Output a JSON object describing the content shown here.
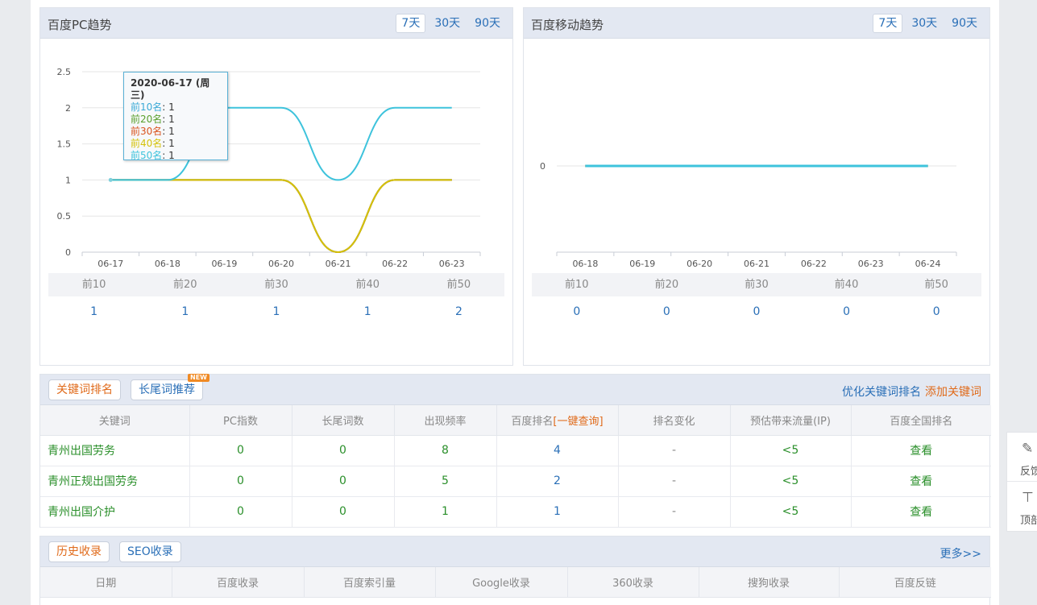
{
  "pc_trend": {
    "title": "百度PC趋势",
    "ranges": [
      "7天",
      "30天",
      "90天"
    ],
    "active_range": "7天",
    "tooltip": {
      "title": "2020-06-17 (周三)",
      "rows": [
        {
          "label": "前10名",
          "value": ": 1",
          "color": "#3aa9d6"
        },
        {
          "label": "前20名",
          "value": ": 1",
          "color": "#5aa02c"
        },
        {
          "label": "前30名",
          "value": ": 1",
          "color": "#d9541e"
        },
        {
          "label": "前40名",
          "value": ": 1",
          "color": "#d4c20a"
        },
        {
          "label": "前50名",
          "value": ": 1",
          "color": "#3ec3dc"
        }
      ]
    },
    "summary": {
      "headers": [
        "前10",
        "前20",
        "前30",
        "前40",
        "前50"
      ],
      "values": [
        "1",
        "1",
        "1",
        "1",
        "2"
      ]
    }
  },
  "mobile_trend": {
    "title": "百度移动趋势",
    "ranges": [
      "7天",
      "30天",
      "90天"
    ],
    "active_range": "7天",
    "summary": {
      "headers": [
        "前10",
        "前20",
        "前30",
        "前40",
        "前50"
      ],
      "values": [
        "0",
        "0",
        "0",
        "0",
        "0"
      ]
    }
  },
  "chart_data": [
    {
      "type": "line",
      "categories": [
        "06-17",
        "06-18",
        "06-19",
        "06-20",
        "06-21",
        "06-22",
        "06-23"
      ],
      "yticks": [
        "0",
        "0.5",
        "1",
        "1.5",
        "2",
        "2.5"
      ],
      "ylim": [
        0,
        2.5
      ],
      "legend_position": "bottom",
      "series": [
        {
          "name": "前10名",
          "color": "#3aa9d6",
          "values": [
            1,
            1,
            1,
            1,
            0,
            1,
            1
          ]
        },
        {
          "name": "前20名",
          "color": "#5aa02c",
          "values": [
            1,
            1,
            1,
            1,
            0,
            1,
            1
          ]
        },
        {
          "name": "前30名",
          "color": "#d9541e",
          "values": [
            1,
            1,
            1,
            1,
            0,
            1,
            1
          ]
        },
        {
          "name": "前40名",
          "color": "#d4c20a",
          "values": [
            1,
            1,
            1,
            1,
            0,
            1,
            1
          ]
        },
        {
          "name": "前50名",
          "color": "#3ec3dc",
          "values": [
            1,
            1,
            2,
            2,
            1,
            2,
            2
          ]
        }
      ]
    },
    {
      "type": "line",
      "categories": [
        "06-18",
        "06-19",
        "06-20",
        "06-21",
        "06-22",
        "06-23",
        "06-24"
      ],
      "yticks": [
        "0"
      ],
      "legend_position": "bottom",
      "series": [
        {
          "name": "前10名",
          "color": "#3aa9d6",
          "values": [
            0,
            0,
            0,
            0,
            0,
            0,
            0
          ]
        },
        {
          "name": "前20名",
          "color": "#5aa02c",
          "values": [
            0,
            0,
            0,
            0,
            0,
            0,
            0
          ]
        },
        {
          "name": "前30名",
          "color": "#d9541e",
          "values": [
            0,
            0,
            0,
            0,
            0,
            0,
            0
          ]
        },
        {
          "name": "前40名",
          "color": "#d4c20a",
          "values": [
            0,
            0,
            0,
            0,
            0,
            0,
            0
          ]
        },
        {
          "name": "前50名",
          "color": "#3ec3dc",
          "values": [
            0,
            0,
            0,
            0,
            0,
            0,
            0
          ]
        }
      ]
    }
  ],
  "keywords": {
    "tabs": [
      "关键词排名",
      "长尾词推荐"
    ],
    "new_badge": "NEW",
    "link_optimize": "优化关键词排名",
    "link_add": "添加关键词",
    "columns": [
      "关键词",
      "PC指数",
      "长尾词数",
      "出现频率",
      "百度排名",
      "[一键查询]",
      "排名变化",
      "预估带来流量(IP)",
      "百度全国排名"
    ],
    "rows": [
      {
        "keyword": "青州出国劳务",
        "pc_index": "0",
        "longtail": "0",
        "frequency": "8",
        "rank": "4",
        "change": "-",
        "traffic": "<5",
        "national": "查看"
      },
      {
        "keyword": "青州正规出国劳务",
        "pc_index": "0",
        "longtail": "0",
        "frequency": "5",
        "rank": "2",
        "change": "-",
        "traffic": "<5",
        "national": "查看"
      },
      {
        "keyword": "青州出国介护",
        "pc_index": "0",
        "longtail": "0",
        "frequency": "1",
        "rank": "1",
        "change": "-",
        "traffic": "<5",
        "national": "查看"
      }
    ]
  },
  "history": {
    "tabs": [
      "历史收录",
      "SEO收录"
    ],
    "more": "更多>>",
    "columns": [
      "日期",
      "百度收录",
      "百度索引量",
      "Google收录",
      "360收录",
      "搜狗收录",
      "百度反链"
    ]
  },
  "side": {
    "feedback": "反馈",
    "top": "顶部"
  }
}
